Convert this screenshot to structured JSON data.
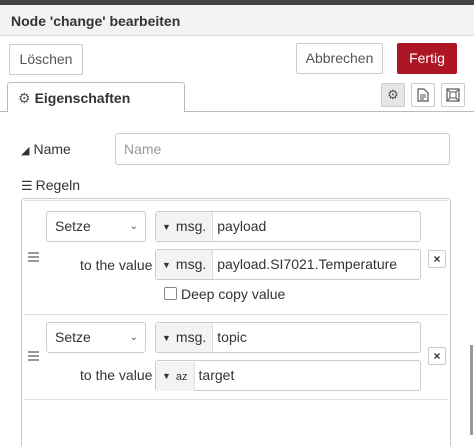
{
  "title": "Node 'change' bearbeiten",
  "toolbar": {
    "delete_label": "Löschen",
    "cancel_label": "Abbrechen",
    "done_label": "Fertig",
    "done_color": "#ad1625"
  },
  "tabs": {
    "properties_label": "Eigenschaften",
    "properties_icon": "gear-icon"
  },
  "form": {
    "name_label": "Name",
    "name_placeholder": "Name",
    "rules_label": "Regeln"
  },
  "rules": [
    {
      "action": "Setze",
      "target_type": "msg.",
      "target_value": "payload",
      "to_label": "to the value",
      "value_type": "msg.",
      "value": "payload.SI7021.Temperature",
      "deep_copy_label": "Deep copy value"
    },
    {
      "action": "Setze",
      "target_type": "msg.",
      "target_value": "topic",
      "to_label": "to the value",
      "value_type": "az",
      "value": "target"
    }
  ]
}
